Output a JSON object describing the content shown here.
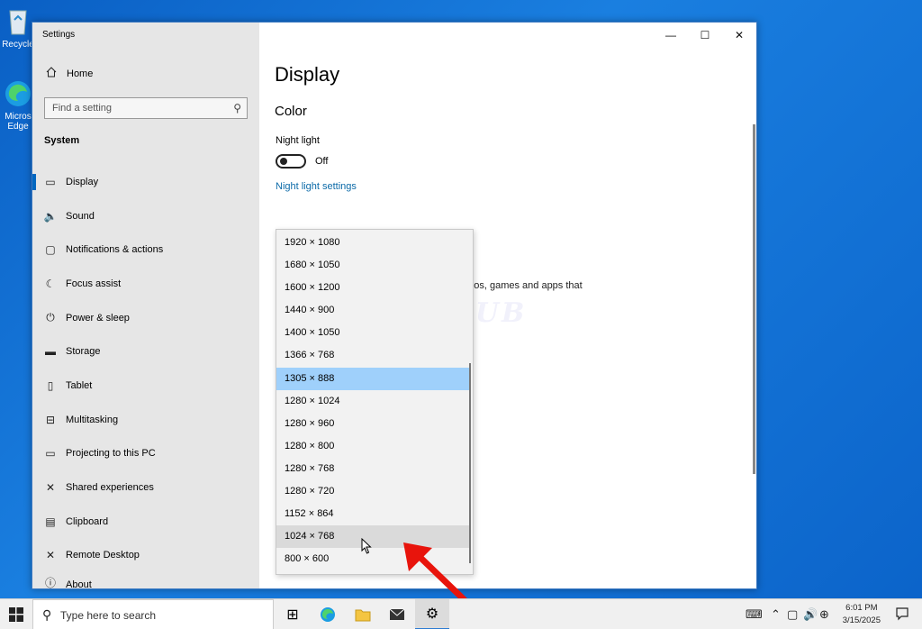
{
  "desktop": {
    "icons": [
      {
        "name": "recycle-bin",
        "label": "Recycle"
      },
      {
        "name": "edge",
        "label": "Micros\nEdge"
      }
    ]
  },
  "window": {
    "title": "Settings",
    "controls": {
      "minimize": "—",
      "maximize": "☐",
      "close": "✕"
    }
  },
  "sidebar": {
    "home": "Home",
    "search_placeholder": "Find a setting",
    "section": "System",
    "items": [
      {
        "label": "Display",
        "icon": "monitor-icon",
        "active": true
      },
      {
        "label": "Sound",
        "icon": "speaker-icon"
      },
      {
        "label": "Notifications & actions",
        "icon": "notification-icon"
      },
      {
        "label": "Focus assist",
        "icon": "moon-icon"
      },
      {
        "label": "Power & sleep",
        "icon": "power-icon"
      },
      {
        "label": "Storage",
        "icon": "storage-icon"
      },
      {
        "label": "Tablet",
        "icon": "tablet-icon"
      },
      {
        "label": "Multitasking",
        "icon": "multitasking-icon"
      },
      {
        "label": "Projecting to this PC",
        "icon": "projecting-icon"
      },
      {
        "label": "Shared experiences",
        "icon": "shared-icon"
      },
      {
        "label": "Clipboard",
        "icon": "clipboard-icon"
      },
      {
        "label": "Remote Desktop",
        "icon": "remote-icon"
      },
      {
        "label": "About",
        "icon": "info-icon"
      }
    ]
  },
  "main": {
    "title": "Display",
    "color_section": "Color",
    "night_light_label": "Night light",
    "night_light_state": "Off",
    "night_light_link": "Night light settings",
    "partial_text": "deos, games and apps that",
    "partial_colon": ";",
    "watermark": "IT Pros HUB"
  },
  "resolution_dropdown": {
    "options": [
      "1920 × 1080",
      "1680 × 1050",
      "1600 × 1200",
      "1440 × 900",
      "1400 × 1050",
      "1366 × 768",
      "1305 × 888",
      "1280 × 1024",
      "1280 × 960",
      "1280 × 800",
      "1280 × 768",
      "1280 × 720",
      "1152 × 864",
      "1024 × 768",
      "800 × 600"
    ],
    "selected": "1305 × 888",
    "hovered": "1024 × 768"
  },
  "taskbar": {
    "search_placeholder": "Type here to search",
    "clock_time": "6:01 PM",
    "clock_date": "3/15/2025"
  },
  "colors": {
    "accent": "#0067c0",
    "link": "#0b6aa8",
    "selected_bg": "#9fd0fb",
    "hover_bg": "#dadada",
    "arrow": "#e8140c"
  }
}
